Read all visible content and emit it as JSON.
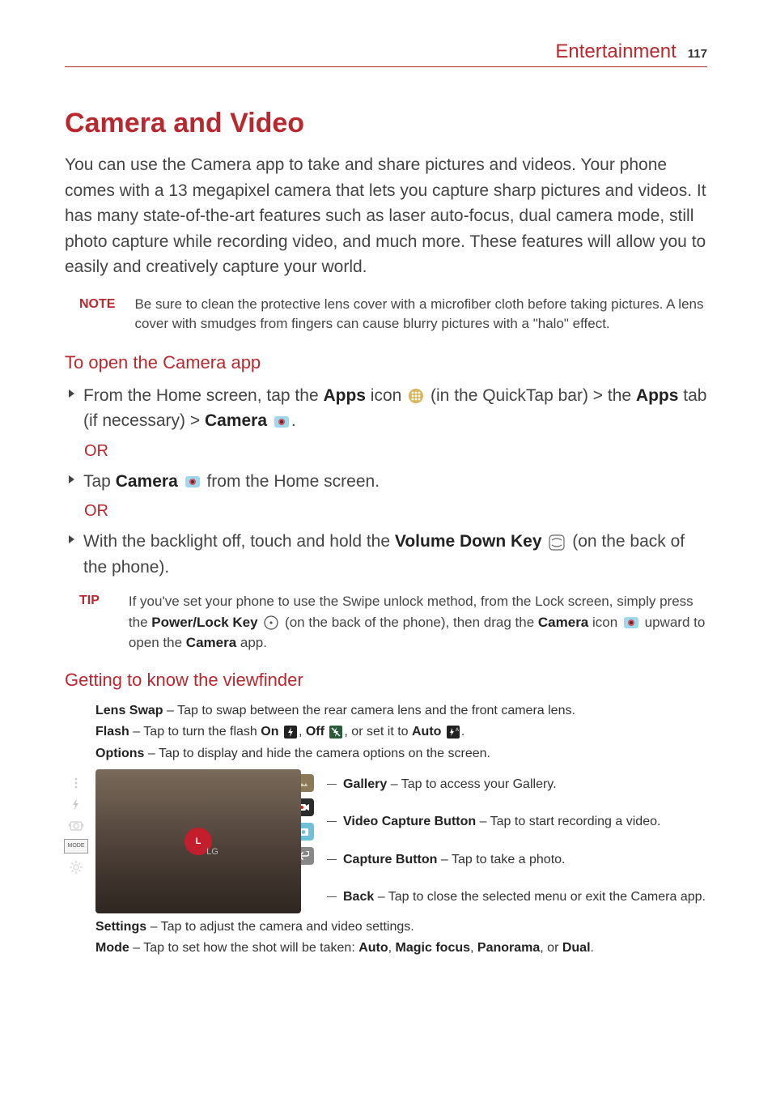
{
  "header": {
    "section": "Entertainment",
    "page": "117"
  },
  "title": "Camera and Video",
  "intro": "You can use the Camera app to take and share pictures and videos. Your phone comes with a 13 megapixel camera that lets you capture sharp pictures and videos. It has many state-of-the-art features such as laser auto-focus, dual camera mode, still photo capture while recording video, and much more. These features will allow you to easily and creatively capture your world.",
  "note": {
    "label": "NOTE",
    "text": "Be sure to clean the protective lens cover with a microfiber cloth before taking pictures. A lens cover with smudges from fingers can cause blurry pictures with a \"halo\" effect."
  },
  "open_camera": {
    "heading": "To open the Camera app",
    "step1_a": "From the Home screen, tap the ",
    "step1_b": "Apps",
    "step1_c": " icon ",
    "step1_d": " (in the QuickTap bar) > the ",
    "step1_e": "Apps",
    "step1_f": " tab (if necessary) > ",
    "step1_g": "Camera",
    "step1_h": ".",
    "or": "OR",
    "step2_a": "Tap ",
    "step2_b": "Camera",
    "step2_c": " from the Home screen.",
    "step3_a": "With the backlight off, touch and hold the ",
    "step3_b": "Volume Down Key",
    "step3_c": " (on the back of the phone)."
  },
  "tip": {
    "label": "TIP",
    "a": "If you've set your phone to use the Swipe unlock method, from the Lock screen, simply press the ",
    "b": "Power/Lock Key",
    "c": " (on the back of the phone), then drag the ",
    "d": "Camera",
    "e": " icon ",
    "f": " upward to open the ",
    "g": "Camera",
    "h": " app."
  },
  "viewfinder": {
    "heading": "Getting to know the viewfinder",
    "lens_swap_l": "Lens Swap",
    "lens_swap_t": " – Tap to swap between the rear camera lens and the front camera lens.",
    "flash_l": "Flash",
    "flash_a": " – Tap to turn the flash ",
    "flash_on": "On",
    "flash_mid": ", ",
    "flash_off": "Off",
    "flash_mid2": ", or set it to ",
    "flash_auto": "Auto",
    "flash_end": ".",
    "options_l": "Options",
    "options_t": " – Tap to display and hide the camera options on the screen.",
    "gallery_l": "Gallery",
    "gallery_t": " – Tap to access your Gallery.",
    "vcap_l": "Video Capture Button",
    "vcap_t": " – Tap to start recording a video.",
    "cap_l": "Capture Button",
    "cap_t": " – Tap to take a photo.",
    "back_l": "Back",
    "back_t": " – Tap to close the selected menu or exit the Camera app.",
    "settings_l": "Settings",
    "settings_t": " – Tap to adjust the camera and video settings.",
    "mode_l": "Mode",
    "mode_a": " – Tap to set how the shot will be taken: ",
    "mode_auto": "Auto",
    "mode_sep1": ", ",
    "mode_magic": "Magic focus",
    "mode_sep2": ", ",
    "mode_pan": "Panorama",
    "mode_sep3": ", or ",
    "mode_dual": "Dual",
    "mode_end": "."
  },
  "icons": {
    "mode_label": "MODE"
  }
}
